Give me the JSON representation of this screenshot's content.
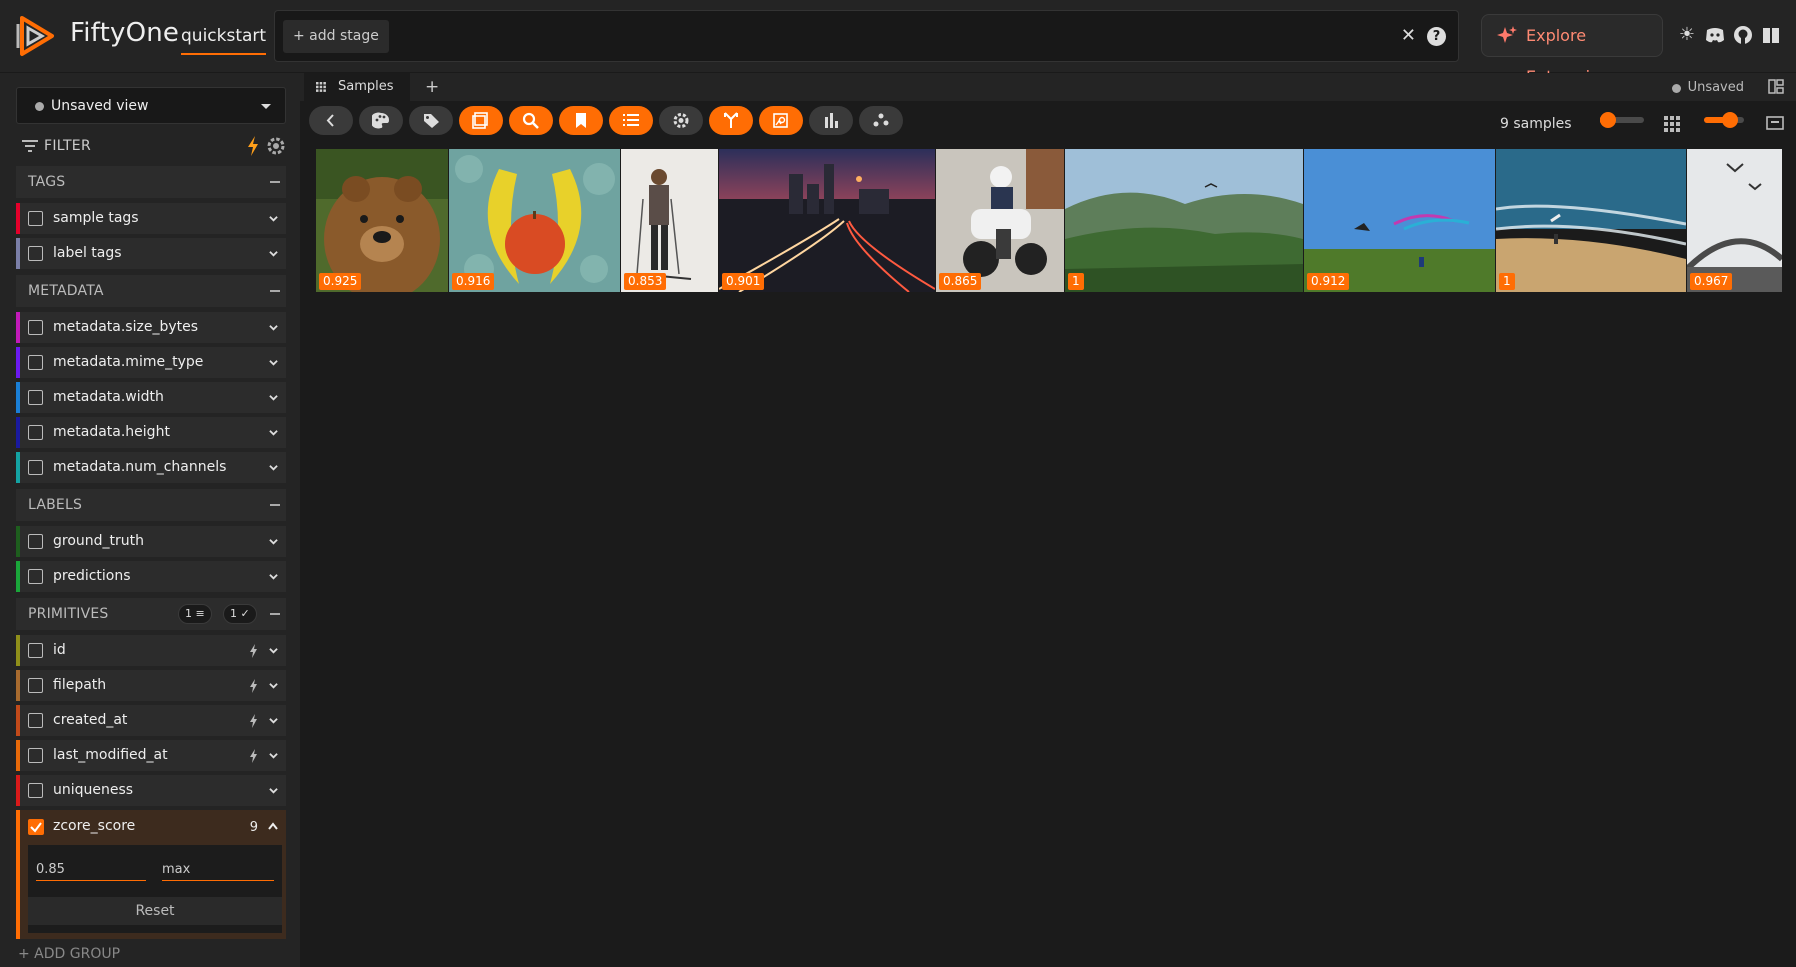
{
  "header": {
    "brand": "FiftyOne",
    "dataset": "quickstart",
    "add_stage": "+ add stage",
    "enterprise": "Explore Enterprise"
  },
  "sidebar": {
    "view_selector": "Unsaved view",
    "filter_label": "FILTER",
    "groups": {
      "tags": {
        "name": "TAGS",
        "fields": [
          {
            "name": "sample tags",
            "color": "#e4002b"
          },
          {
            "name": "label tags",
            "color": "#7b7fa8"
          }
        ]
      },
      "metadata": {
        "name": "METADATA",
        "fields": [
          {
            "name": "metadata.size_bytes",
            "color": "#c21ab9"
          },
          {
            "name": "metadata.mime_type",
            "color": "#6b1af0"
          },
          {
            "name": "metadata.width",
            "color": "#1a7fd6"
          },
          {
            "name": "metadata.height",
            "color": "#1a1a9e"
          },
          {
            "name": "metadata.num_channels",
            "color": "#14a3a3"
          }
        ]
      },
      "labels": {
        "name": "LABELS",
        "fields": [
          {
            "name": "ground_truth",
            "color": "#1e5e1e"
          },
          {
            "name": "predictions",
            "color": "#1aa63a"
          }
        ]
      },
      "primitives": {
        "name": "PRIMITIVES",
        "pill_filter": "1",
        "pill_check": "1",
        "fields": [
          {
            "name": "id",
            "color": "#8f8f1a"
          },
          {
            "name": "filepath",
            "color": "#a86b2f"
          },
          {
            "name": "created_at",
            "color": "#c24a1a"
          },
          {
            "name": "last_modified_at",
            "color": "#e86a0a"
          },
          {
            "name": "uniqueness",
            "color": "#d91a1a"
          }
        ]
      }
    },
    "zcore": {
      "name": "zcore_score",
      "count": "9",
      "min_value": "0.85",
      "max_placeholder": "max",
      "reset": "Reset"
    },
    "add_group": "+ ADD GROUP"
  },
  "main": {
    "tab": "Samples",
    "status": "Unsaved",
    "sample_count": "9 samples",
    "thumb_size_level": 0.06,
    "grid_level": 0.65,
    "samples": [
      {
        "score": "0.925",
        "subject": "brown-bear"
      },
      {
        "score": "0.916",
        "subject": "bananas-apple"
      },
      {
        "score": "0.853",
        "subject": "skier"
      },
      {
        "score": "0.901",
        "subject": "city-traffic-night"
      },
      {
        "score": "0.865",
        "subject": "police-motorcycle"
      },
      {
        "score": "1",
        "subject": "green-valley"
      },
      {
        "score": "0.912",
        "subject": "kites-field"
      },
      {
        "score": "1",
        "subject": "beach-waves"
      },
      {
        "score": "0.967",
        "subject": "bridge-birds"
      }
    ]
  }
}
